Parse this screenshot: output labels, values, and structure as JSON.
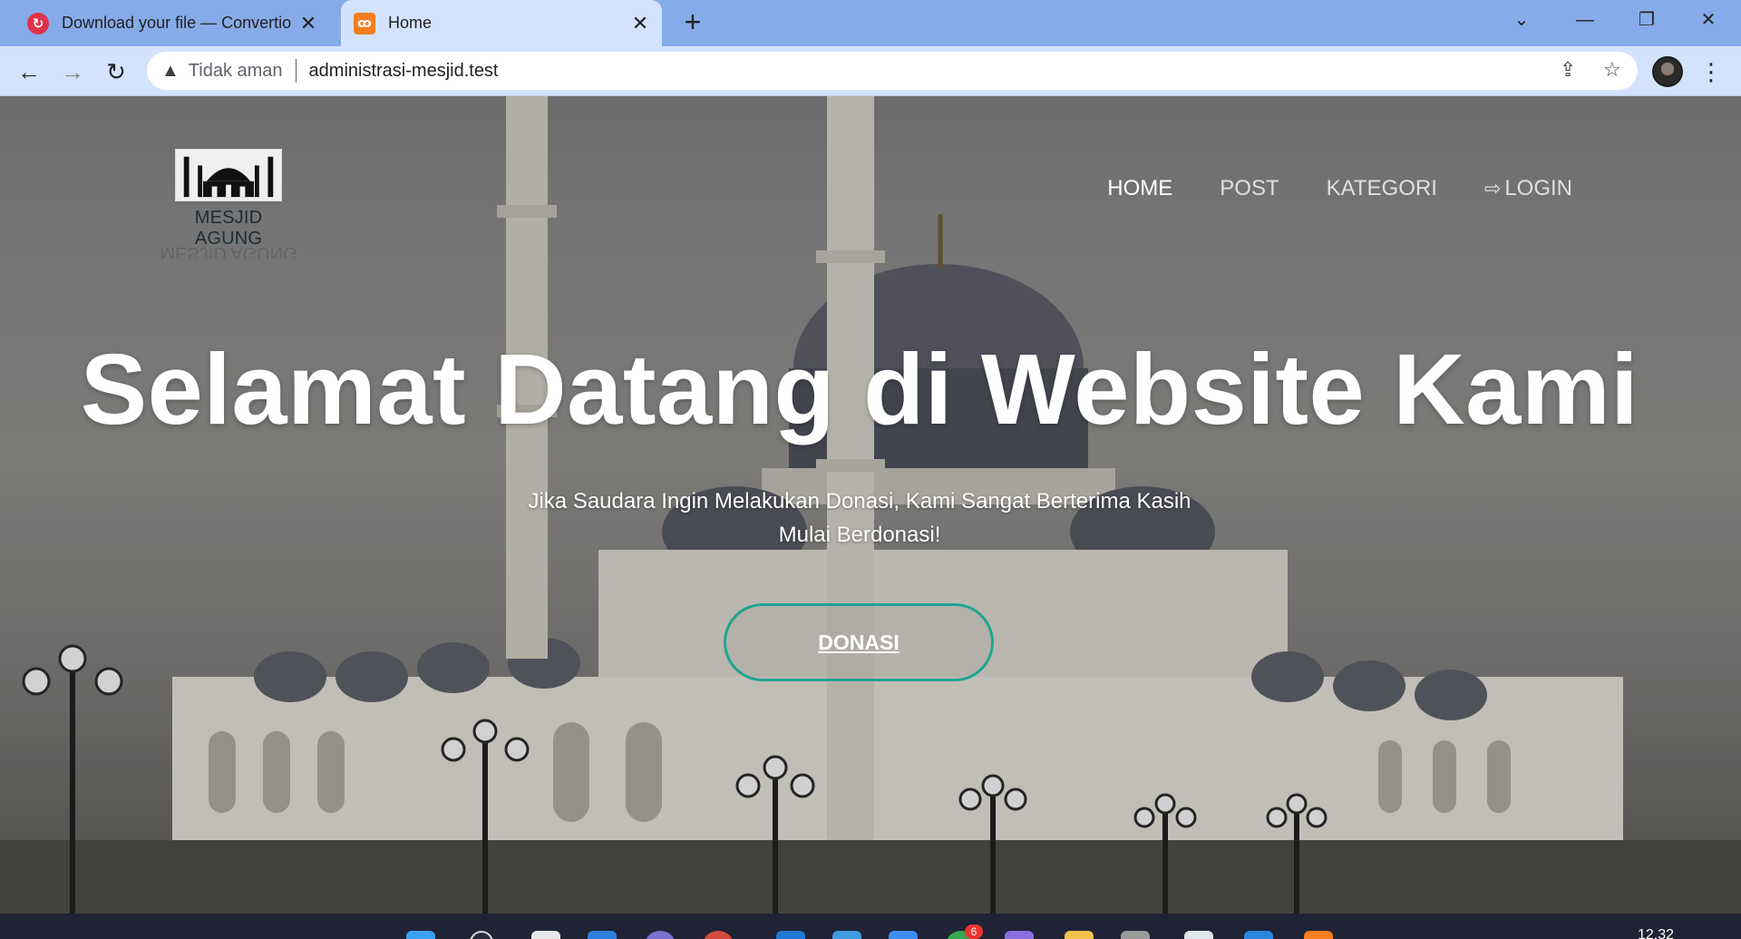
{
  "browser": {
    "tabs": [
      {
        "title": "Download your file — Convertio",
        "favicon": "convertio-icon",
        "close": "✕"
      },
      {
        "title": "Home",
        "favicon": "xampp-icon",
        "close": "✕"
      }
    ],
    "new_tab": "+",
    "address": {
      "security_label": "Tidak aman",
      "url": "administrasi-mesjid.test"
    }
  },
  "site": {
    "logo_text": "MESJID AGUNG",
    "nav": [
      {
        "label": "HOME",
        "active": true
      },
      {
        "label": "POST",
        "active": false
      },
      {
        "label": "KATEGORI",
        "active": false
      },
      {
        "label": "LOGIN",
        "active": false,
        "icon": "login-icon"
      }
    ],
    "hero": {
      "title": "Selamat Datang di Website Kami",
      "subtitle_line1": "Jika Saudara Ingin Melakukan Donasi, Kami Sangat Berterima Kasih",
      "subtitle_line2": "Mulai Berdonasi!",
      "button": "DONASI"
    }
  },
  "taskbar": {
    "clock": "12.32",
    "badge_count": "6"
  },
  "colors": {
    "accent_button_border": "#1fa58e",
    "tab_strip": "#86abe8",
    "toolbar": "#d3e3fd"
  }
}
